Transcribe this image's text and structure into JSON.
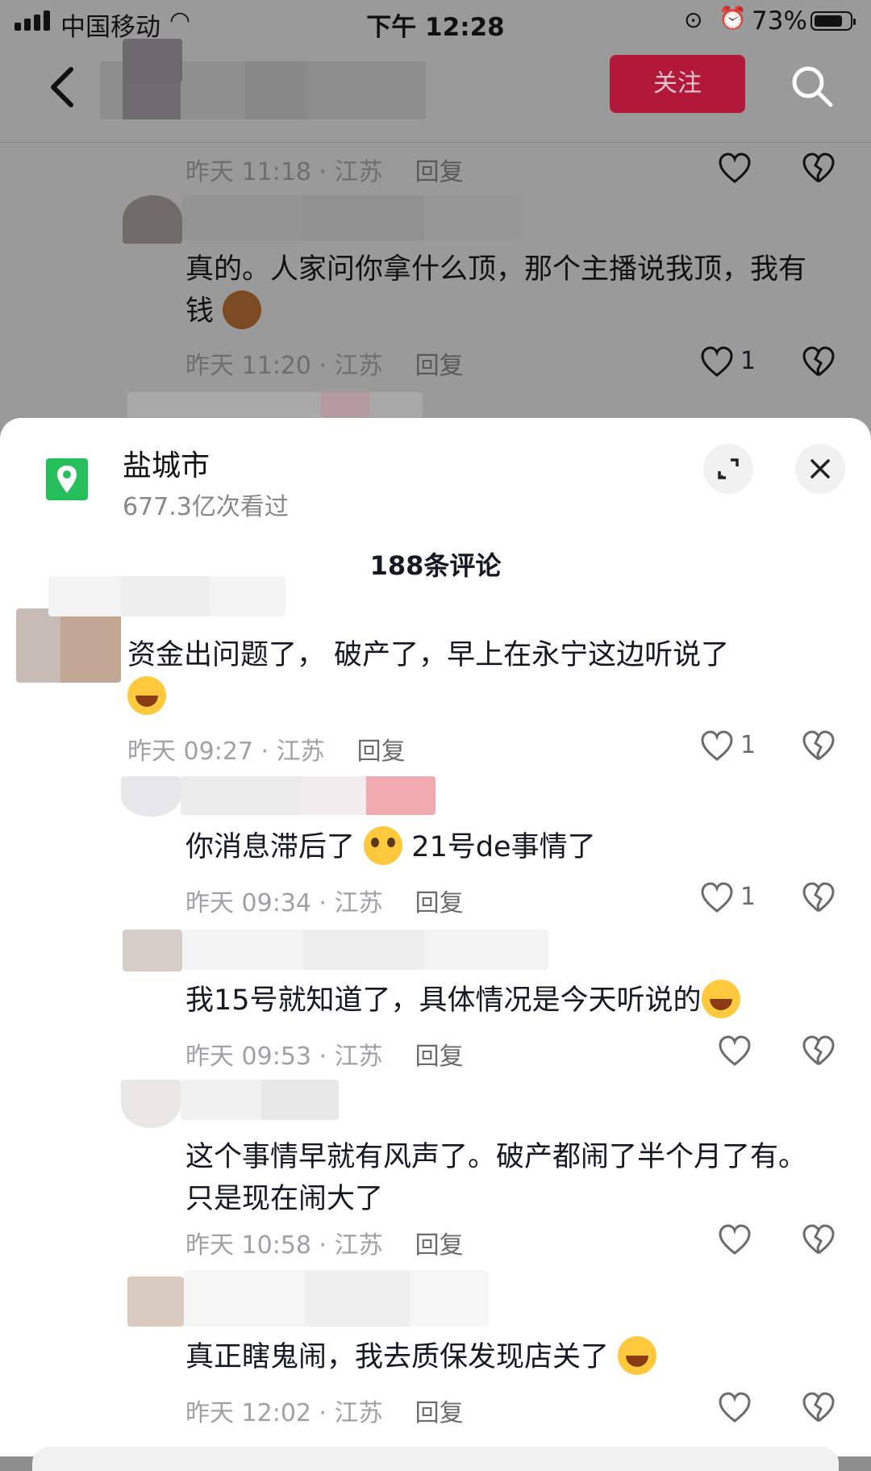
{
  "status": {
    "carrier": "中国移动",
    "time": "下午 12:28",
    "battery": "73%"
  },
  "nav": {
    "follow": "关注"
  },
  "bg_comments": [
    {
      "meta": "昨天 11:18 · 江苏",
      "reply": "回复"
    },
    {
      "text": "真的。人家问你拿什么顶，那个主播说我顶，我有钱",
      "meta": "昨天 11:20 · 江苏",
      "reply": "回复",
      "likes": "1"
    }
  ],
  "sheet": {
    "location": "盐城市",
    "views": "677.3亿次看过",
    "count": "188条评论"
  },
  "comments": [
    {
      "text": "资金出问题了， 破产了，早上在永宁这边听说了",
      "meta": "昨天 09:27 · 江苏",
      "reply": "回复",
      "likes": "1",
      "emoji": "laugh-cry"
    },
    {
      "text1": "你消息滞后了",
      "text2": "21号de事情了",
      "meta": "昨天 09:34 · 江苏",
      "reply": "回复",
      "likes": "1",
      "emoji": "pleading"
    },
    {
      "text": "我15号就知道了，具体情况是今天听说的",
      "meta": "昨天 09:53 · 江苏",
      "reply": "回复",
      "emoji": "laugh-cry"
    },
    {
      "text": "这个事情早就有风声了。破产都闹了半个月了有。只是现在闹大了",
      "meta": "昨天 10:58 · 江苏",
      "reply": "回复"
    },
    {
      "text": "真正瞎鬼闹，我去质保发现店关了",
      "meta": "昨天 12:02 · 江苏",
      "reply": "回复",
      "emoji": "laugh-cry"
    }
  ],
  "icons": {
    "location": "map-pin-icon",
    "expand": "expand-icon",
    "close": "close-icon",
    "like": "heart-icon",
    "dislike": "broken-heart-icon",
    "search": "search-icon",
    "back": "back-arrow-icon"
  },
  "colors": {
    "follow": "#b3173a",
    "location_badge": "#25c05c"
  }
}
